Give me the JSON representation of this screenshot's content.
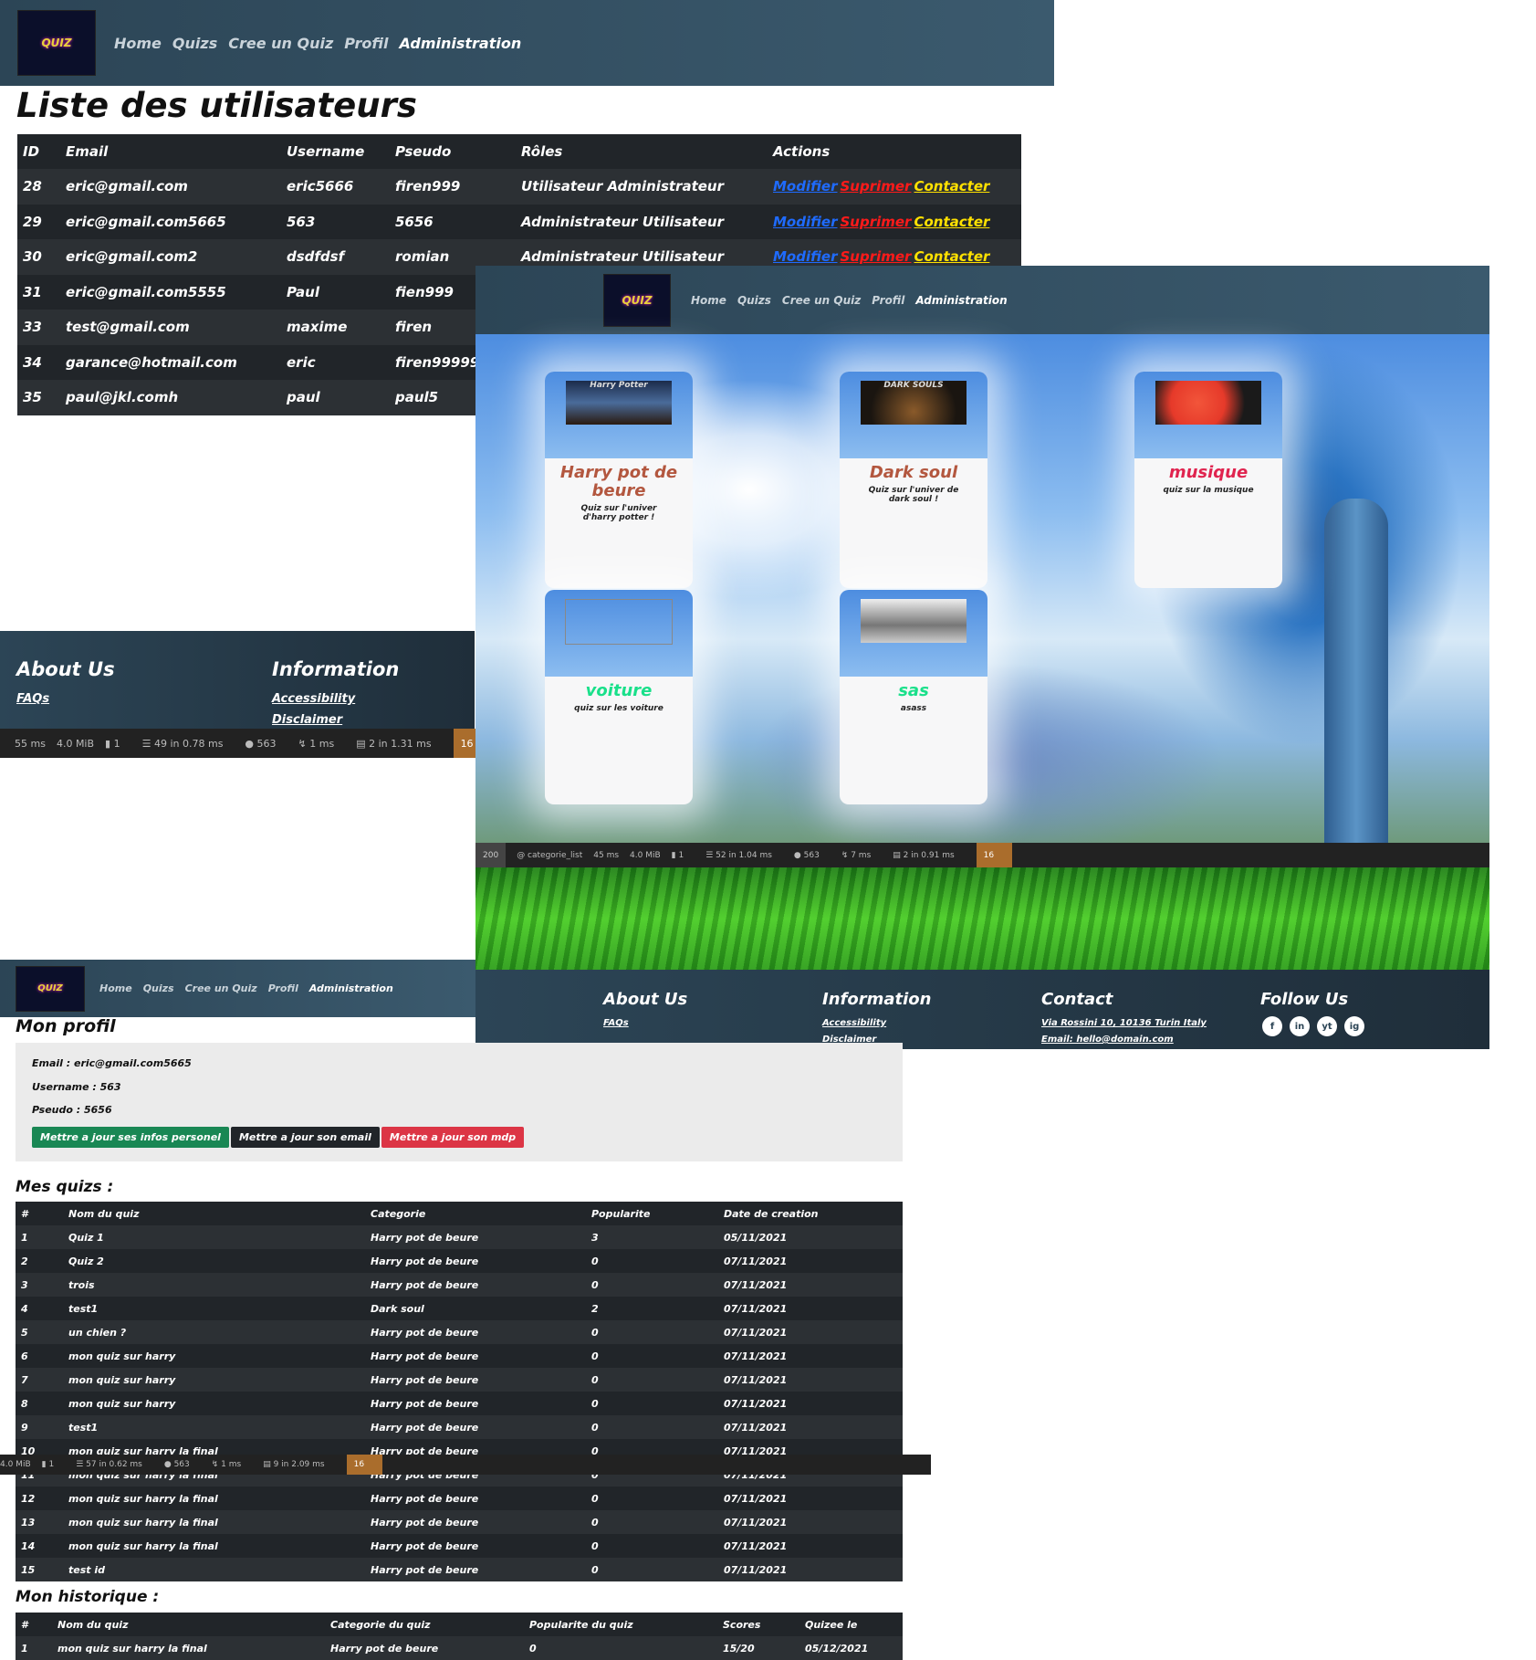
{
  "nav": {
    "logo_text": "QUIZ",
    "links": [
      "Home",
      "Quizs",
      "Cree un Quiz",
      "Profil",
      "Administration"
    ]
  },
  "users_page": {
    "title": "Liste des utilisateurs",
    "columns": [
      "ID",
      "Email",
      "Username",
      "Pseudo",
      "Rôles",
      "Actions"
    ],
    "rows": [
      [
        "28",
        "eric@gmail.com",
        "eric5666",
        "firen999",
        "Utilisateur Administrateur"
      ],
      [
        "29",
        "eric@gmail.com5665",
        "563",
        "5656",
        "Administrateur Utilisateur"
      ],
      [
        "30",
        "eric@gmail.com2",
        "dsdfdsf",
        "romian",
        "Administrateur Utilisateur"
      ],
      [
        "31",
        "eric@gmail.com5555",
        "Paul",
        "fien999",
        ""
      ],
      [
        "33",
        "test@gmail.com",
        "maxime",
        "firen",
        ""
      ],
      [
        "34",
        "garance@hotmail.com",
        "eric",
        "firen999999",
        ""
      ],
      [
        "35",
        "paul@jkl.comh",
        "paul",
        "paul5",
        ""
      ]
    ],
    "actions": {
      "edit": "Modifier",
      "delete": "Suprimer",
      "contact": "Contacter"
    },
    "footer": {
      "about_title": "About Us",
      "about_link": "FAQs",
      "info_title": "Information",
      "info_links": [
        "Accessibility",
        "Disclaimer"
      ]
    },
    "debugbar": {
      "time": "55 ms",
      "memory": "4.0 MiB",
      "requests": "1",
      "twig": "49 in 0.78 ms",
      "user": "563",
      "ajax": "1 ms",
      "db": "2 in 1.31 ms",
      "version": "16"
    }
  },
  "category_page": {
    "cards": [
      {
        "title": "Harry pot de beure",
        "desc": "Quiz sur l'univer d'harry potter !",
        "color": "#b3573f",
        "img": "Harry Potter"
      },
      {
        "title": "Dark soul",
        "desc": "Quiz sur l'univer de dark soul !",
        "color": "#b3573f",
        "img": "DARK SOULS"
      },
      {
        "title": "musique",
        "desc": "quiz sur la musique",
        "color": "#e0244f",
        "img": ""
      },
      {
        "title": "voiture",
        "desc": "quiz sur les voiture",
        "color": "#19e08a",
        "img": ""
      },
      {
        "title": "sas",
        "desc": "asass",
        "color": "#19e08a",
        "img": ""
      }
    ],
    "debugbar": {
      "status": "200",
      "route": "@ categorie_list",
      "time": "45 ms",
      "memory": "4.0 MiB",
      "requests": "1",
      "twig": "52 in 1.04 ms",
      "user": "563",
      "ajax": "7 ms",
      "db": "2 in 0.91 ms",
      "version": "16"
    },
    "footer": {
      "about_title": "About Us",
      "about_link": "FAQs",
      "info_title": "Information",
      "info_links": [
        "Accessibility",
        "Disclaimer"
      ],
      "contact_title": "Contact",
      "contact_address": "Via Rossini 10, 10136 Turin Italy",
      "contact_email": "Email: hello@domain.com",
      "follow_title": "Follow Us",
      "social": [
        "f",
        "in",
        "yt",
        "ig"
      ]
    }
  },
  "profile_page": {
    "title": "Mon profil",
    "email_line": "Email : eric@gmail.com5665",
    "username_line": "Username : 563",
    "pseudo_line": "Pseudo : 5656",
    "buttons": [
      "Mettre a jour ses infos personel",
      "Mettre a jour son email",
      "Mettre a jour son mdp"
    ],
    "quizzes_title": "Mes quizs :",
    "quiz_columns": [
      "#",
      "Nom du quiz",
      "Categorie",
      "Popularite",
      "Date de creation"
    ],
    "quiz_rows": [
      [
        "1",
        "Quiz 1",
        "Harry pot de beure",
        "3",
        "05/11/2021"
      ],
      [
        "2",
        "Quiz 2",
        "Harry pot de beure",
        "0",
        "07/11/2021"
      ],
      [
        "3",
        "trois",
        "Harry pot de beure",
        "0",
        "07/11/2021"
      ],
      [
        "4",
        "test1",
        "Dark soul",
        "2",
        "07/11/2021"
      ],
      [
        "5",
        "un chien ?",
        "Harry pot de beure",
        "0",
        "07/11/2021"
      ],
      [
        "6",
        "mon quiz sur harry",
        "Harry pot de beure",
        "0",
        "07/11/2021"
      ],
      [
        "7",
        "mon quiz sur harry",
        "Harry pot de beure",
        "0",
        "07/11/2021"
      ],
      [
        "8",
        "mon quiz sur harry",
        "Harry pot de beure",
        "0",
        "07/11/2021"
      ],
      [
        "9",
        "test1",
        "Harry pot de beure",
        "0",
        "07/11/2021"
      ],
      [
        "10",
        "mon quiz sur harry la final",
        "Harry pot de beure",
        "0",
        "07/11/2021"
      ],
      [
        "11",
        "mon quiz sur harry la final",
        "Harry pot de beure",
        "0",
        "07/11/2021"
      ],
      [
        "12",
        "mon quiz sur harry la final",
        "Harry pot de beure",
        "0",
        "07/11/2021"
      ],
      [
        "13",
        "mon quiz sur harry la final",
        "Harry pot de beure",
        "0",
        "07/11/2021"
      ],
      [
        "14",
        "mon quiz sur harry la final",
        "Harry pot de beure",
        "0",
        "07/11/2021"
      ],
      [
        "15",
        "test id",
        "Harry pot de beure",
        "0",
        "07/11/2021"
      ]
    ],
    "history_title": "Mon historique :",
    "history_columns": [
      "#",
      "Nom du quiz",
      "Categorie du quiz",
      "Popularite du quiz",
      "Scores",
      "Quizee le"
    ],
    "history_rows": [
      [
        "1",
        "mon quiz sur harry la final",
        "Harry pot de beure",
        "0",
        "15/20",
        "05/12/2021"
      ]
    ],
    "debugbar": {
      "memory": "4.0 MiB",
      "requests": "1",
      "twig": "57 in 0.62 ms",
      "user": "563",
      "ajax": "1 ms",
      "db": "9 in 2.09 ms",
      "version": "16"
    }
  }
}
